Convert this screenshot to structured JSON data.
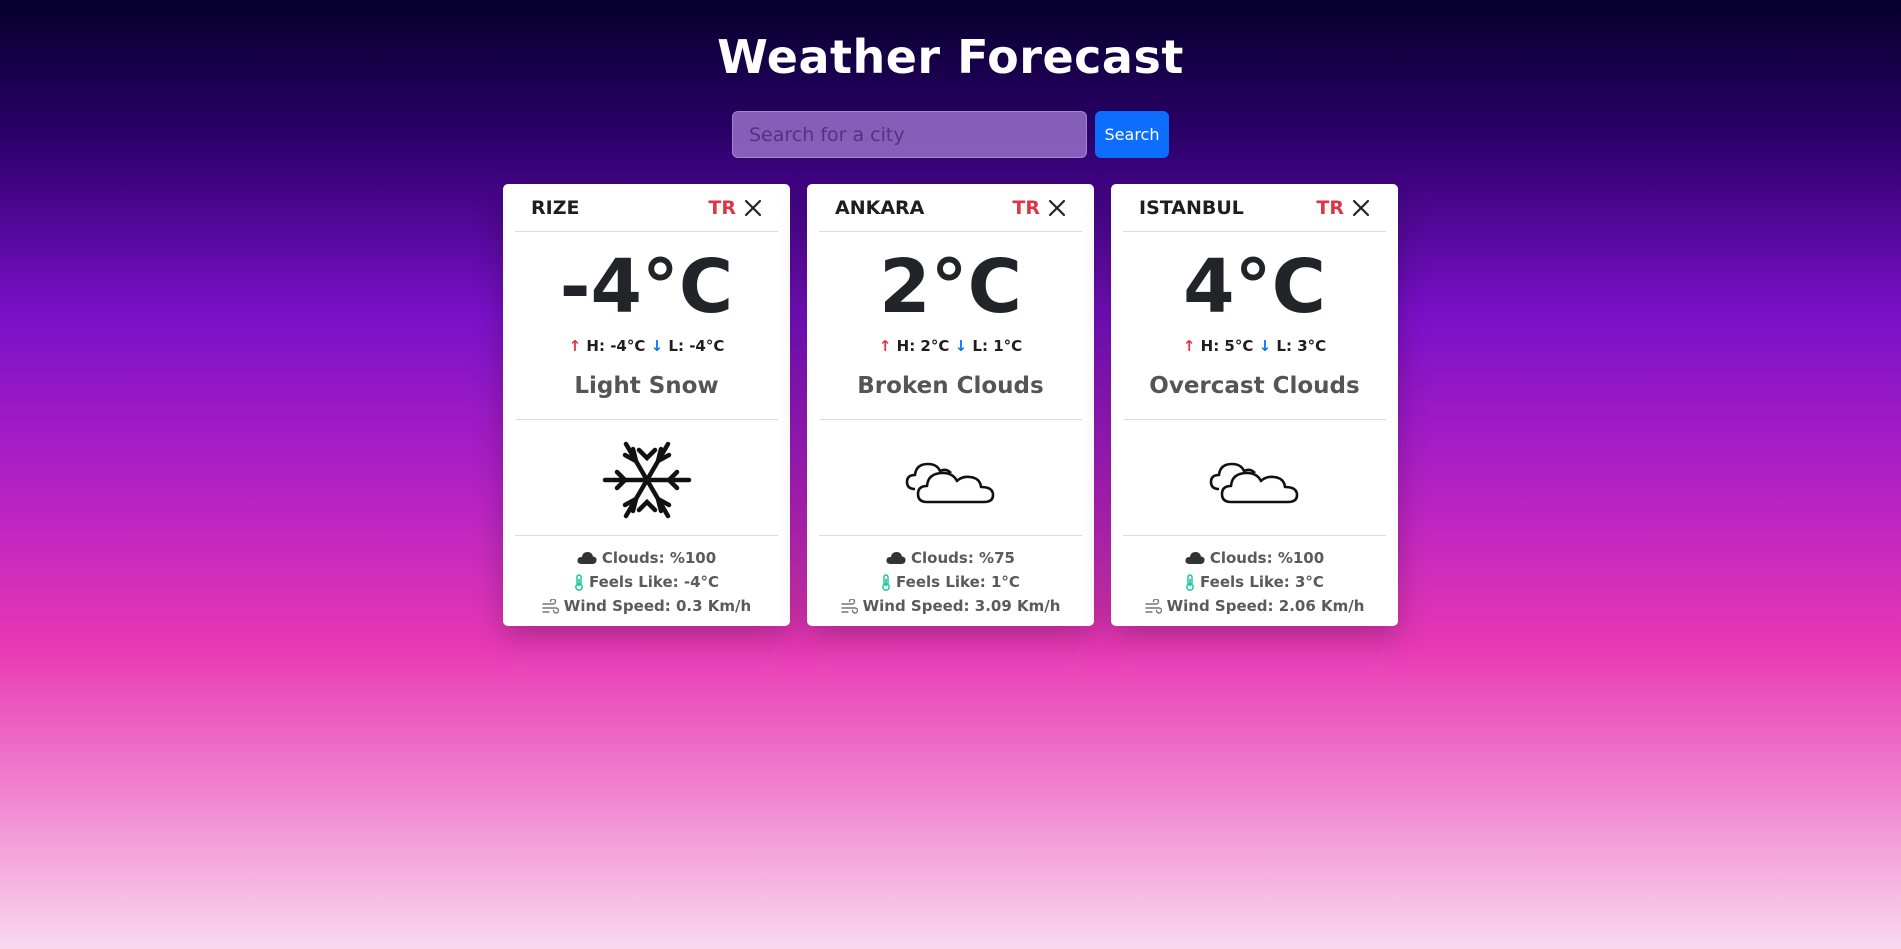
{
  "page": {
    "title": "Weather Forecast"
  },
  "search": {
    "placeholder": "Search for a city",
    "button_label": "Search"
  },
  "cards": [
    {
      "city": "RIZE",
      "country": "TR",
      "temperature": "-4°C",
      "high_label": "H: -4°C",
      "low_label": "L: -4°C",
      "description": "Light Snow",
      "icon": "snowflake-icon",
      "clouds": "Clouds: %100",
      "feels_like": "Feels Like: -4°C",
      "wind_speed": "Wind Speed: 0.3 Km/h"
    },
    {
      "city": "ANKARA",
      "country": "TR",
      "temperature": "2°C",
      "high_label": "H: 2°C",
      "low_label": "L: 1°C",
      "description": "Broken Clouds",
      "icon": "clouds-icon",
      "clouds": "Clouds: %75",
      "feels_like": "Feels Like: 1°C",
      "wind_speed": "Wind Speed: 3.09 Km/h"
    },
    {
      "city": "ISTANBUL",
      "country": "TR",
      "temperature": "4°C",
      "high_label": "H: 5°C",
      "low_label": "L: 3°C",
      "description": "Overcast Clouds",
      "icon": "clouds-icon",
      "clouds": "Clouds: %100",
      "feels_like": "Feels Like: 3°C",
      "wind_speed": "Wind Speed: 2.06 Km/h"
    }
  ],
  "colors": {
    "country_code": "#dc3545",
    "high_arrow": "#dc3545",
    "low_arrow": "#0d6efd",
    "search_button": "#0d6efd",
    "thermometer": "#20c997"
  }
}
